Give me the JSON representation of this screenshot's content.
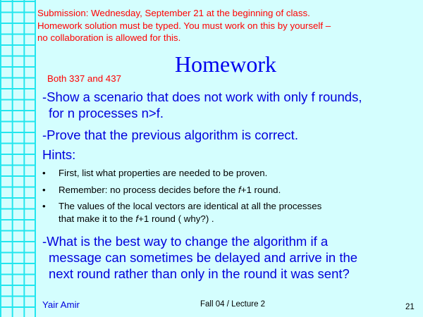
{
  "note_lines": [
    "Submission: Wednesday, September 21 at the beginning of class.",
    "Homework solution must be typed. You must work on this by yourself –",
    "no collaboration is allowed for this."
  ],
  "title": "Homework",
  "audience": "Both 337 and 437",
  "items": [
    {
      "line1": "-Show a scenario that does not work with only f rounds,",
      "line2": "for n processes  n>f."
    },
    {
      "line1": "-Prove that the previous algorithm is correct."
    },
    {
      "line1": "Hints:"
    }
  ],
  "hints": [
    {
      "text": "First, list what properties are needed to be proven."
    },
    {
      "pre": "Remember: no process decides before the ",
      "var": "f",
      "post": "+1 round."
    },
    {
      "line1": "The values of the local vectors are identical at all the processes",
      "pre": "that make it to the ",
      "var": "f",
      "post": "+1 round ( why?) ."
    }
  ],
  "last_item": [
    "-What is the best way to change the algorithm if a",
    "message can sometimes be delayed and arrive in the",
    "next round rather than only in the round it was sent?"
  ],
  "footer": {
    "author": "Yair Amir",
    "course": "Fall 04 / Lecture 2",
    "page": "21"
  }
}
